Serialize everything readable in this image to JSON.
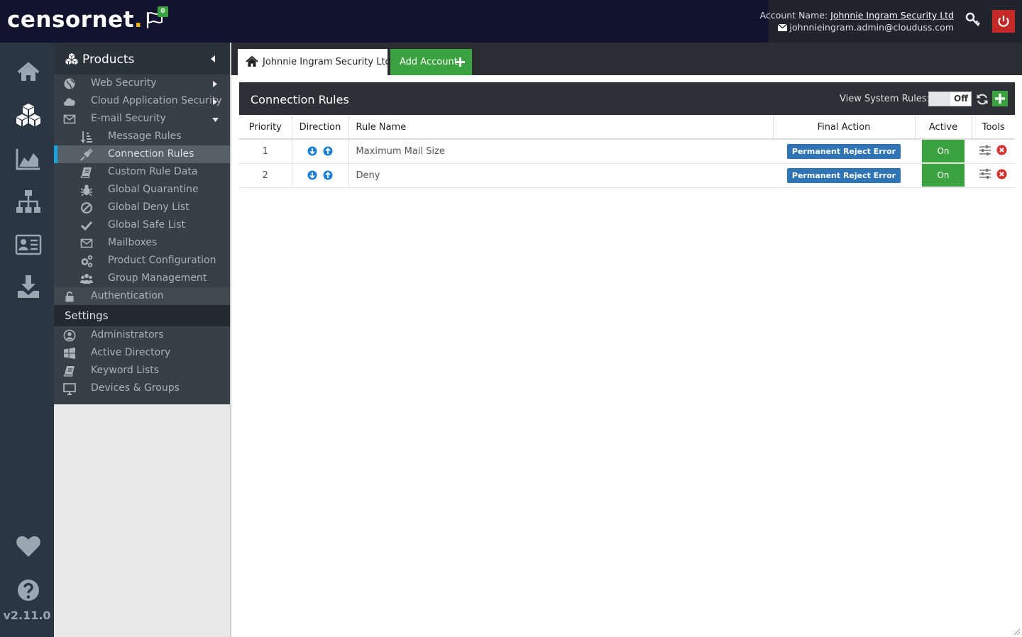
{
  "brand": {
    "logo_text": "censornet",
    "logo_dot": ".",
    "dot_color": "#f1b51c"
  },
  "header": {
    "notification_count": "0",
    "account_label": "Account Name:",
    "account_name": "Johnnie Ingram Security Ltd",
    "account_email": "johnnieingram.admin@clouduss.com",
    "key_icon": "key-icon",
    "power_icon": "power-icon"
  },
  "rail": {
    "icons": [
      "home-icon",
      "products-cubes-icon",
      "reports-chart-icon",
      "network-sitemap-icon",
      "directory-card-icon",
      "download-icon",
      "heart-icon",
      "help-icon"
    ],
    "version": "v2.11.0"
  },
  "nav": {
    "products_label": "Products",
    "items": [
      {
        "label": "Web Security",
        "icon": "globe-icon"
      },
      {
        "label": "Cloud Application Security",
        "icon": "cloud-icon"
      },
      {
        "label": "E-mail Security",
        "icon": "envelope-icon"
      },
      {
        "label": "Message Rules",
        "icon": "sort-order-icon"
      },
      {
        "label": "Connection Rules",
        "icon": "plug-icon"
      },
      {
        "label": "Custom Rule Data",
        "icon": "book-icon"
      },
      {
        "label": "Global Quarantine",
        "icon": "bug-icon"
      },
      {
        "label": "Global Deny List",
        "icon": "ban-icon"
      },
      {
        "label": "Global Safe List",
        "icon": "check-icon"
      },
      {
        "label": "Mailboxes",
        "icon": "mailbox-icon"
      },
      {
        "label": "Product Configuration",
        "icon": "gears-icon"
      },
      {
        "label": "Group Management",
        "icon": "users-icon"
      },
      {
        "label": "Authentication",
        "icon": "lock-icon"
      }
    ],
    "settings_label": "Settings",
    "settings_items": [
      {
        "label": "Administrators",
        "icon": "user-circle-icon"
      },
      {
        "label": "Active Directory",
        "icon": "windows-icon"
      },
      {
        "label": "Keyword Lists",
        "icon": "book-icon"
      },
      {
        "label": "Devices & Groups",
        "icon": "desktop-icon"
      }
    ]
  },
  "tabs": {
    "account_tab": "Johnnie Ingram Security Ltd",
    "add_account": "Add Account"
  },
  "panel": {
    "title": "Connection Rules",
    "view_system_rules_label": "View System Rules:",
    "toggle_state": "Off"
  },
  "table": {
    "columns": [
      "Priority",
      "Direction",
      "Rule Name",
      "Final Action",
      "Active",
      "Tools"
    ],
    "rows": [
      {
        "priority": "1",
        "name": "Maximum Mail Size",
        "action": "Permanent Reject Error",
        "active": "On"
      },
      {
        "priority": "2",
        "name": "Deny",
        "action": "Permanent Reject Error",
        "active": "On"
      }
    ]
  },
  "colors": {
    "accent_green": "#3aa23e",
    "action_blue": "#2f74b5",
    "danger_red": "#c62828",
    "active_indicator": "#1aa3df"
  }
}
